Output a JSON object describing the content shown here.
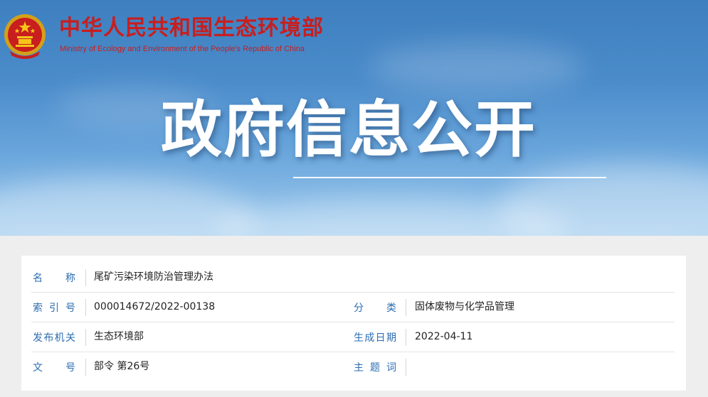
{
  "header": {
    "ministry_cn": "中华人民共和国生态环境部",
    "ministry_en": "Ministry of Ecology and Environment of the People's Republic of China",
    "banner_title": "政府信息公开",
    "emblem_icon": "national-emblem-icon"
  },
  "colors": {
    "brand_red": "#c81e1e",
    "label_blue": "#2b6cb0",
    "banner_blue": "#4b8ccb"
  },
  "info": {
    "name_label": "名称",
    "name_value": "尾矿污染环境防治管理办法",
    "index_label": "索引号",
    "index_value": "000014672/2022-00138",
    "category_label": "分类",
    "category_value": "固体废物与化学品管理",
    "issuer_label": "发布机关",
    "issuer_value": "生态环境部",
    "date_label": "生成日期",
    "date_value": "2022-04-11",
    "docno_label": "文号",
    "docno_value": "部令 第26号",
    "subject_label": "主题词",
    "subject_value": ""
  }
}
